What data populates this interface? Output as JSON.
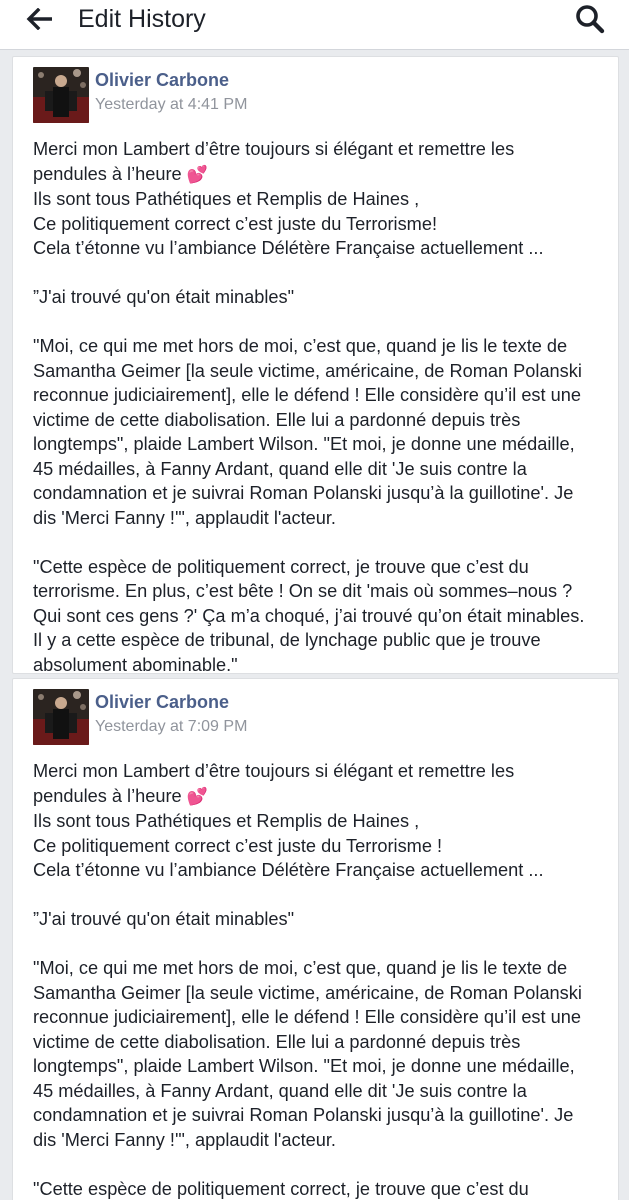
{
  "appbar": {
    "title": "Edit History",
    "back_icon": "arrow-left-icon",
    "search_icon": "search-icon"
  },
  "colors": {
    "author": "#4b5f8a",
    "timestamp": "#90949c",
    "text": "#1d2129",
    "background": "#e9ebee",
    "heart": "#e6418d"
  },
  "posts": [
    {
      "author": "Olivier Carbone",
      "timestamp": "Yesterday at 4:41 PM",
      "paragraphs": [
        [
          "Merci mon Lambert d’être toujours si élégant et remettre les",
          "pendules à l’heure 💕",
          "Ils sont tous Pathétiques et Remplis de Haines ,",
          "Ce politiquement correct c’est juste du Terrorisme!",
          "Cela t’étonne vu l’ambiance Délétère Française actuellement ..."
        ],
        [
          "”J'ai trouvé qu'on était minables\""
        ],
        [
          "\"Moi, ce qui me met hors de moi, c’est que, quand je lis le texte de",
          "Samantha Geimer [la seule victime, américaine, de Roman Polanski",
          "reconnue judiciairement], elle le défend ! Elle considère qu’il est une",
          "victime de cette diabolisation. Elle lui a pardonné depuis très",
          "longtemps\", plaide Lambert Wilson. \"Et moi, je donne une médaille,",
          "45 médailles, à Fanny Ardant, quand elle dit 'Je suis contre la",
          "condamnation et je suivrai Roman Polanski jusqu’à la guillotine'. Je",
          "dis 'Merci Fanny !'\", applaudit l'acteur."
        ],
        [
          "\"Cette espèce de politiquement correct, je trouve que c’est du",
          "terrorisme. En plus, c’est bête ! On se dit 'mais où sommes–nous ?",
          "Qui sont ces gens ?' Ça m’a choqué, j’ai trouvé qu’on était minables.",
          "Il y a cette espèce de tribunal, de lynchage public que je trouve",
          "absolument abominable.\""
        ]
      ]
    },
    {
      "author": "Olivier Carbone",
      "timestamp": "Yesterday at 7:09 PM",
      "paragraphs": [
        [
          "Merci mon Lambert d’être toujours si élégant et remettre les",
          "pendules à l’heure 💕",
          "Ils sont tous Pathétiques et Remplis de Haines ,",
          "Ce politiquement correct c’est juste du Terrorisme !",
          "Cela t’étonne vu l’ambiance Délétère Française actuellement ..."
        ],
        [
          "”J'ai trouvé qu'on était minables\""
        ],
        [
          "\"Moi, ce qui me met hors de moi, c’est que, quand je lis le texte de",
          "Samantha Geimer [la seule victime, américaine, de Roman Polanski",
          "reconnue judiciairement], elle le défend ! Elle considère qu’il est une",
          "victime de cette diabolisation. Elle lui a pardonné depuis très",
          "longtemps\", plaide Lambert Wilson. \"Et moi, je donne une médaille,",
          "45 médailles, à Fanny Ardant, quand elle dit 'Je suis contre la",
          "condamnation et je suivrai Roman Polanski jusqu’à la guillotine'. Je",
          "dis 'Merci Fanny !'\", applaudit l'acteur."
        ],
        [
          "\"Cette espèce de politiquement correct, je trouve que c’est du"
        ]
      ]
    }
  ]
}
